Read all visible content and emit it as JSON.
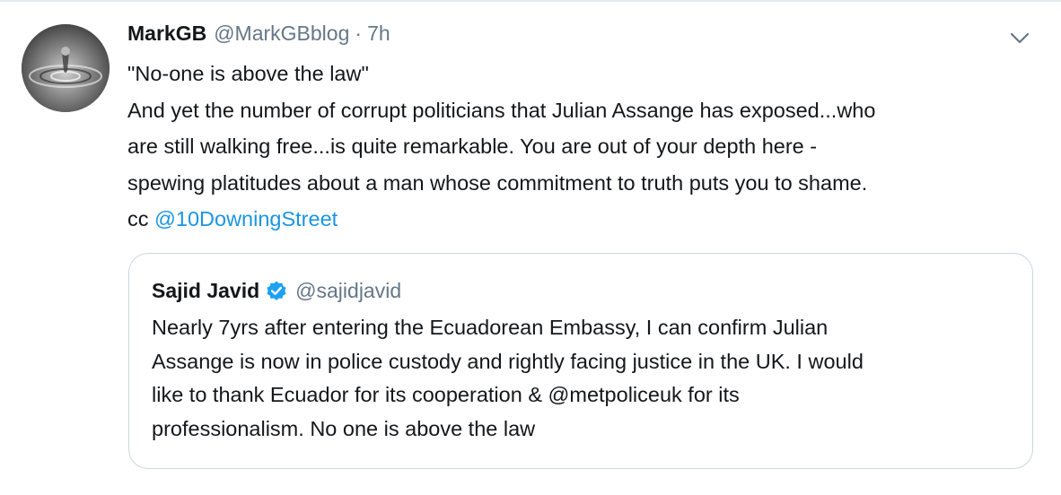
{
  "tweet": {
    "author_name": "MarkGB",
    "author_handle": "@MarkGBblog",
    "separator": "·",
    "time": "7h",
    "lines": [
      "\"No-one is above the law\"",
      "And yet the number of corrupt politicians that Julian Assange has exposed...who",
      "are still walking free...is quite remarkable. You are out of your depth here -",
      "spewing platitudes about a man whose commitment to truth puts you to shame."
    ],
    "cc_prefix": "cc ",
    "cc_mention": "@10DowningStreet",
    "menu_icon": "chevron-down-icon"
  },
  "quoted_tweet": {
    "author_name": "Sajid Javid",
    "verified_icon": "verified-badge-icon",
    "author_handle": "@sajidjavid",
    "lines": [
      "Nearly 7yrs after entering the Ecuadorean Embassy, I can confirm Julian",
      "Assange is now in police custody and rightly facing justice in the UK. I would",
      "like to thank Ecuador for its cooperation & @metpoliceuk for its",
      "professionalism. No one is above the law"
    ]
  },
  "colors": {
    "text": "#14171a",
    "secondary": "#657786",
    "link": "#1b95e0",
    "verified": "#1da1f2",
    "border": "#ccd6dd"
  }
}
